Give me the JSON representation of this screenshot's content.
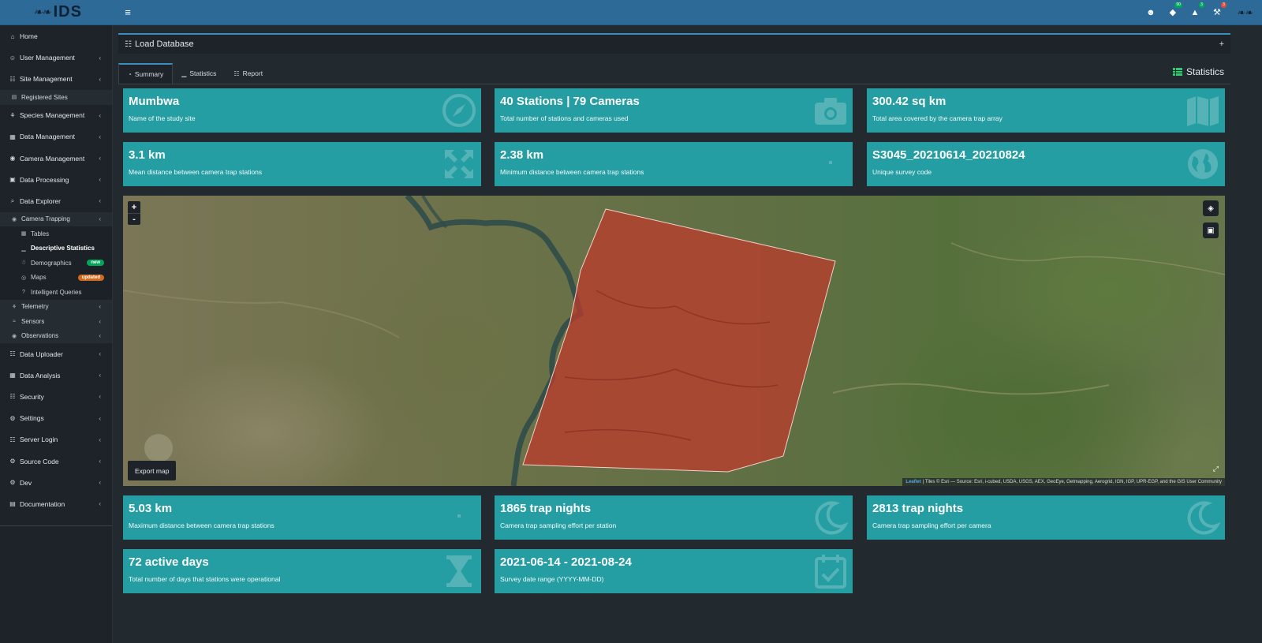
{
  "topbar": {
    "logo_mark": "❧❧",
    "logo_text": "IDS",
    "menu_glyph": "≡",
    "icons": [
      {
        "name": "user-icon",
        "glyph": "☻",
        "badge": ""
      },
      {
        "name": "shield-icon",
        "glyph": "◆",
        "badge": "90"
      },
      {
        "name": "warning-icon",
        "glyph": "▲",
        "badge": "3"
      },
      {
        "name": "tools-icon",
        "glyph": "⚒",
        "badge": "3"
      }
    ],
    "brand_right": "❧❧"
  },
  "sidebar": {
    "items": [
      {
        "label": "Home",
        "icon": "⌂"
      },
      {
        "label": "User Management",
        "icon": "☺"
      },
      {
        "label": "Site Management",
        "icon": "☷"
      },
      {
        "label": "Registered Sites",
        "icon": "▤"
      },
      {
        "label": "Species Management",
        "icon": "⚘"
      },
      {
        "label": "Data Management",
        "icon": "▦"
      },
      {
        "label": "Camera Management",
        "icon": "◉"
      },
      {
        "label": "Data Processing",
        "icon": "▣"
      },
      {
        "label": "Data Explorer",
        "icon": "⌕"
      },
      {
        "label": "Camera Trapping",
        "icon": "◉"
      },
      {
        "label": "Tables",
        "icon": "▦"
      },
      {
        "label": "Descriptive Statistics",
        "icon": "▁"
      },
      {
        "label": "Demographics",
        "icon": "☃"
      },
      {
        "label": "Maps",
        "icon": "◎"
      },
      {
        "label": "Intelligent Queries",
        "icon": "?"
      },
      {
        "label": "Telemetry",
        "icon": "⚘"
      },
      {
        "label": "Sensors",
        "icon": "≈"
      },
      {
        "label": "Observations",
        "icon": "◉"
      },
      {
        "label": "Data Uploader",
        "icon": "☷"
      },
      {
        "label": "Data Analysis",
        "icon": "▦"
      },
      {
        "label": "Security",
        "icon": "☷"
      },
      {
        "label": "Settings",
        "icon": "⚙"
      },
      {
        "label": "Server Login",
        "icon": "☷"
      },
      {
        "label": "Source Code",
        "icon": "⚙"
      },
      {
        "label": "Dev",
        "icon": "⚙"
      },
      {
        "label": "Documentation",
        "icon": "▤"
      }
    ],
    "chevron": "‹",
    "badge_new": "new",
    "badge_updated": "updated"
  },
  "box": {
    "title": "Load Database",
    "icon": "☷",
    "plus": "+"
  },
  "tabs": [
    {
      "label": "Summary",
      "icon": "◔"
    },
    {
      "label": "Statistics",
      "icon": "▁"
    },
    {
      "label": "Report",
      "icon": "☷"
    }
  ],
  "stats_label": "Statistics",
  "cards": [
    {
      "value": "Mumbwa",
      "desc": "Name of the study site",
      "icon": "compass-icon"
    },
    {
      "value": "40 Stations | 79 Cameras",
      "desc": "Total number of stations and cameras used",
      "icon": "camera-icon"
    },
    {
      "value": "300.42 sq km",
      "desc": "Total area covered by the camera trap array",
      "icon": "map-icon"
    },
    {
      "value": "3.1 km",
      "desc": "Mean distance between camera trap stations",
      "icon": "arrows-icon"
    },
    {
      "value": "2.38 km",
      "desc": "Minimum distance between camera trap stations",
      "icon": "small-dot-icon"
    },
    {
      "value": "S3045_20210614_20210824",
      "desc": "Unique survey code",
      "icon": "globe-icon"
    },
    {
      "value": "5.03 km",
      "desc": "Maximum distance between camera trap stations",
      "icon": "small-dot-icon"
    },
    {
      "value": "1865 trap nights",
      "desc": "Camera trap sampling effort per station",
      "icon": "moon-icon"
    },
    {
      "value": "2813 trap nights",
      "desc": "Camera trap sampling effort per camera",
      "icon": "moon-icon"
    },
    {
      "value": "72 active days",
      "desc": "Total number of days that stations were operational",
      "icon": "hourglass-icon"
    },
    {
      "value": "2021-06-14 - 2021-08-24",
      "desc": "Survey date range (YYYY-MM-DD)",
      "icon": "calendar-check-icon"
    }
  ],
  "map": {
    "zoom_in": "+",
    "zoom_out": "-",
    "layers_glyph": "◈",
    "fullscreen_glyph": "▣",
    "export_label": "Export map",
    "attribution_link": "Leaflet",
    "attribution_text": "| Tiles © Esri — Source: Esri, i-cubed, USDA, USGS, AEX, GeoEye, Getmapping, Aerogrid, IGN, IGP, UPR-EGP, and the GIS User Community",
    "expand_glyph": "⤢",
    "polygon_color": "#c0392b"
  }
}
